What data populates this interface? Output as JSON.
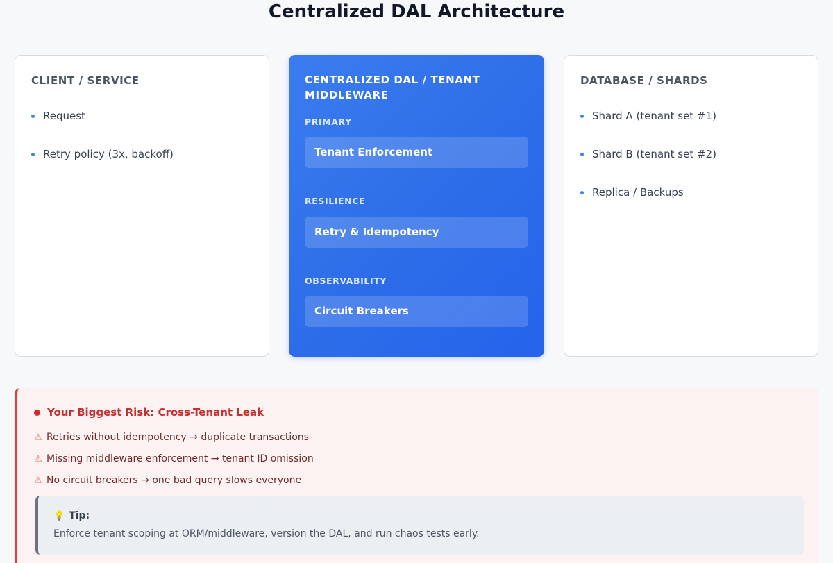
{
  "title": "Centralized DAL Architecture",
  "client": {
    "heading": "CLIENT / SERVICE",
    "items": [
      "Request",
      "Retry policy (3x, backoff)"
    ]
  },
  "dal": {
    "heading": "CENTRALIZED DAL / TENANT MIDDLEWARE",
    "groups": [
      {
        "label": "PRIMARY",
        "box": "Tenant Enforcement"
      },
      {
        "label": "RESILIENCE",
        "box": "Retry & Idempotency"
      },
      {
        "label": "OBSERVABILITY",
        "box": "Circuit Breakers"
      }
    ]
  },
  "database": {
    "heading": "DATABASE / SHARDS",
    "items": [
      "Shard A (tenant set #1)",
      "Shard B (tenant set #2)",
      "Replica / Backups"
    ]
  },
  "risk": {
    "title": "Your Biggest Risk: Cross-Tenant Leak",
    "warn_icon": "warning-icon",
    "items": [
      "Retries without idempotency → duplicate transactions",
      "Missing middleware enforcement → tenant ID omission",
      "No circuit breakers → one bad query slows everyone"
    ]
  },
  "tip": {
    "icon": "lightbulb-icon",
    "label": "Tip:",
    "text": "Enforce tenant scoping at ORM/middleware, version the DAL, and run chaos tests early."
  },
  "colors": {
    "accent": "#2563eb",
    "risk": "#dc2626",
    "bullet": "#3b82f6"
  }
}
